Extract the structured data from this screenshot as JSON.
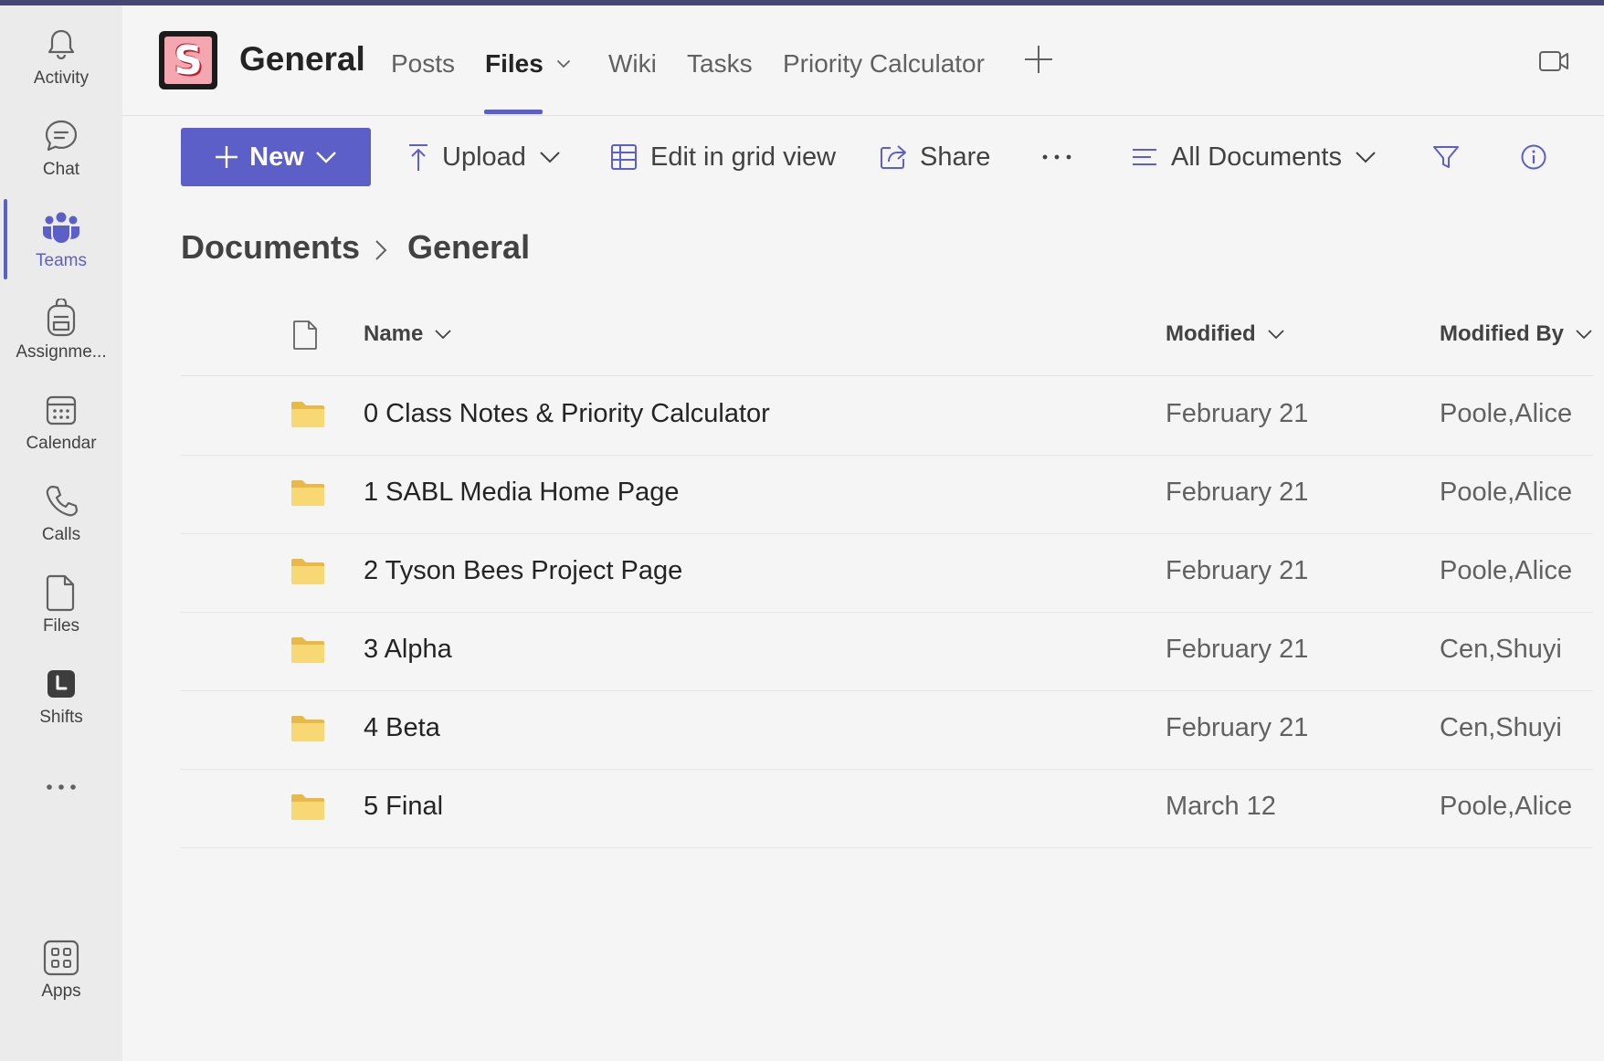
{
  "rail": {
    "items": [
      {
        "label": "Activity",
        "icon": "bell-icon"
      },
      {
        "label": "Chat",
        "icon": "chat-bubble-icon"
      },
      {
        "label": "Teams",
        "icon": "teams-icon"
      },
      {
        "label": "Assignme...",
        "icon": "backpack-icon"
      },
      {
        "label": "Calendar",
        "icon": "calendar-icon"
      },
      {
        "label": "Calls",
        "icon": "phone-icon"
      },
      {
        "label": "Files",
        "icon": "file-icon"
      },
      {
        "label": "Shifts",
        "icon": "clock-icon"
      },
      {
        "label": "",
        "icon": "more-icon"
      },
      {
        "label": "Apps",
        "icon": "apps-grid-icon"
      }
    ],
    "active": "Teams"
  },
  "header": {
    "team_logo_letter": "S",
    "channel_title": "General",
    "tabs": [
      "Posts",
      "Files",
      "Wiki",
      "Tasks",
      "Priority Calculator"
    ],
    "active_tab": "Files"
  },
  "toolbar": {
    "new_label": "New",
    "upload_label": "Upload",
    "grid_label": "Edit in grid view",
    "share_label": "Share",
    "more_label": "···",
    "view_label": "All Documents"
  },
  "breadcrumb": {
    "root": "Documents",
    "current": "General"
  },
  "table": {
    "columns": {
      "name": "Name",
      "modified": "Modified",
      "modified_by": "Modified By"
    },
    "rows": [
      {
        "name": "0 Class Notes & Priority Calculator",
        "modified": "February 21",
        "modified_by": "Poole,Alice"
      },
      {
        "name": "1 SABL Media Home Page",
        "modified": "February 21",
        "modified_by": "Poole,Alice"
      },
      {
        "name": "2 Tyson Bees Project Page",
        "modified": "February 21",
        "modified_by": "Poole,Alice"
      },
      {
        "name": "3 Alpha",
        "modified": "February 21",
        "modified_by": "Cen,Shuyi"
      },
      {
        "name": "4 Beta",
        "modified": "February 21",
        "modified_by": "Cen,Shuyi"
      },
      {
        "name": "5 Final",
        "modified": "March 12",
        "modified_by": "Poole,Alice"
      }
    ]
  },
  "colors": {
    "accent": "#5b5fc7",
    "topbar": "#464775",
    "folder": "#f8d775"
  }
}
